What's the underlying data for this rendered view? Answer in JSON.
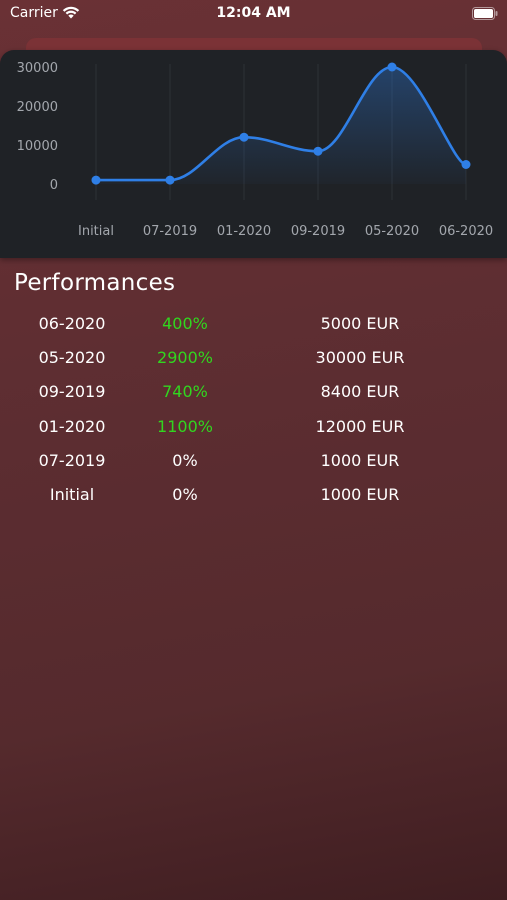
{
  "status_bar": {
    "carrier": "Carrier",
    "time": "12:04 AM"
  },
  "section_title": "Performances",
  "colors": {
    "accent": "#2f7fe6",
    "gain": "#31d61f",
    "neutral": "#ffffff"
  },
  "performances": [
    {
      "date": "06-2020",
      "pct": "400%",
      "value": "5000 EUR",
      "status": "gain"
    },
    {
      "date": "05-2020",
      "pct": "2900%",
      "value": "30000 EUR",
      "status": "gain"
    },
    {
      "date": "09-2019",
      "pct": "740%",
      "value": "8400 EUR",
      "status": "gain"
    },
    {
      "date": "01-2020",
      "pct": "1100%",
      "value": "12000 EUR",
      "status": "gain"
    },
    {
      "date": "07-2019",
      "pct": "0%",
      "value": "1000 EUR",
      "status": "neutral"
    },
    {
      "date": "Initial",
      "pct": "0%",
      "value": "1000 EUR",
      "status": "neutral"
    }
  ],
  "chart_data": {
    "type": "line",
    "categories": [
      "Initial",
      "07-2019",
      "01-2020",
      "09-2019",
      "05-2020",
      "06-2020"
    ],
    "series": [
      {
        "values": [
          1000,
          1000,
          12000,
          8400,
          30000,
          5000
        ]
      }
    ],
    "yticks": [
      "30000",
      "20000",
      "10000",
      "0"
    ],
    "ylim": [
      0,
      30000
    ],
    "grid": "vertical",
    "area_fill": true,
    "smooth": true
  }
}
